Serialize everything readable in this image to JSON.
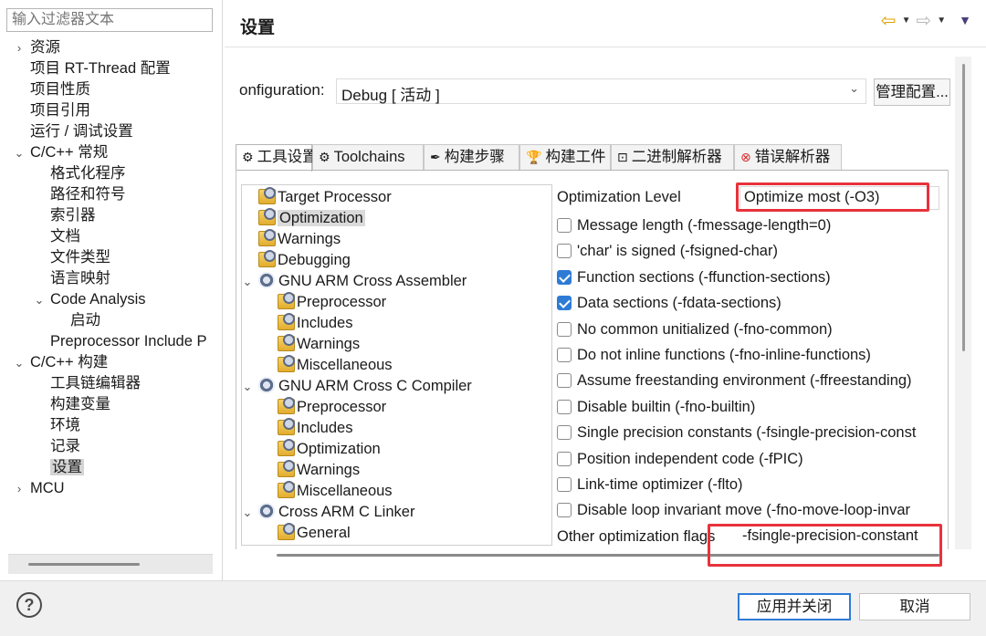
{
  "filter": {
    "placeholder": "输入过滤器文本"
  },
  "nav": [
    {
      "label": "资源",
      "tw": "›"
    },
    {
      "label": "项目 RT-Thread 配置"
    },
    {
      "label": "项目性质"
    },
    {
      "label": "项目引用"
    },
    {
      "label": "运行 / 调试设置"
    },
    {
      "label": "C/C++ 常规",
      "tw": "⌄"
    },
    {
      "label": "格式化程序"
    },
    {
      "label": "路径和符号"
    },
    {
      "label": "索引器"
    },
    {
      "label": "文档"
    },
    {
      "label": "文件类型"
    },
    {
      "label": "语言映射"
    },
    {
      "label": "Code Analysis",
      "tw": "⌄"
    },
    {
      "label": "启动"
    },
    {
      "label": "Preprocessor Include P"
    },
    {
      "label": "C/C++ 构建",
      "tw": "⌄"
    },
    {
      "label": "工具链编辑器"
    },
    {
      "label": "构建变量"
    },
    {
      "label": "环境"
    },
    {
      "label": "记录"
    },
    {
      "label": "设置"
    },
    {
      "label": "MCU",
      "tw": "›"
    }
  ],
  "header": {
    "title": "设置"
  },
  "config": {
    "label": "onfiguration:",
    "value": "Debug  [ 活动 ]",
    "manage_button": "管理配置..."
  },
  "tabs": [
    {
      "label": "工具设置",
      "icon": "tool-settings-icon"
    },
    {
      "label": "Toolchains",
      "icon": "toolchains-icon"
    },
    {
      "label": "构建步骤",
      "icon": "build-steps-icon"
    },
    {
      "label": "构建工件",
      "icon": "build-artifact-icon"
    },
    {
      "label": "二进制解析器",
      "icon": "binary-parser-icon"
    },
    {
      "label": "错误解析器",
      "icon": "error-parser-icon"
    }
  ],
  "tree": [
    {
      "label": "Target Processor"
    },
    {
      "label": "Optimization",
      "selected": true
    },
    {
      "label": "Warnings"
    },
    {
      "label": "Debugging"
    },
    {
      "label": "GNU ARM Cross Assembler",
      "tw": "⌄"
    },
    {
      "label": "Preprocessor"
    },
    {
      "label": "Includes"
    },
    {
      "label": "Warnings"
    },
    {
      "label": "Miscellaneous"
    },
    {
      "label": "GNU ARM Cross C Compiler",
      "tw": "⌄"
    },
    {
      "label": "Preprocessor"
    },
    {
      "label": "Includes"
    },
    {
      "label": "Optimization"
    },
    {
      "label": "Warnings"
    },
    {
      "label": "Miscellaneous"
    },
    {
      "label": "Cross ARM C Linker",
      "tw": "⌄"
    },
    {
      "label": "General"
    }
  ],
  "options": {
    "level_label": "Optimization Level",
    "level_value": "Optimize most (-O3)",
    "checks": [
      {
        "label": "Message length (-fmessage-length=0)",
        "checked": false
      },
      {
        "label": "'char' is signed (-fsigned-char)",
        "checked": false
      },
      {
        "label": "Function sections (-ffunction-sections)",
        "checked": true
      },
      {
        "label": "Data sections (-fdata-sections)",
        "checked": true
      },
      {
        "label": "No common unitialized (-fno-common)",
        "checked": false
      },
      {
        "label": "Do not inline functions (-fno-inline-functions)",
        "checked": false
      },
      {
        "label": "Assume freestanding environment (-ffreestanding)",
        "checked": false
      },
      {
        "label": "Disable builtin (-fno-builtin)",
        "checked": false
      },
      {
        "label": "Single precision constants (-fsingle-precision-const",
        "checked": false
      },
      {
        "label": "Position independent code (-fPIC)",
        "checked": false
      },
      {
        "label": "Link-time optimizer (-flto)",
        "checked": false
      },
      {
        "label": "Disable loop invariant move (-fno-move-loop-invar",
        "checked": false
      }
    ],
    "other_label": "Other optimization flags",
    "other_value": "-fsingle-precision-constant"
  },
  "buttons": {
    "apply": "应用并关闭",
    "cancel": "取消"
  },
  "colors": {
    "accent": "#2e7bd6",
    "highlight": "#e8323c"
  }
}
